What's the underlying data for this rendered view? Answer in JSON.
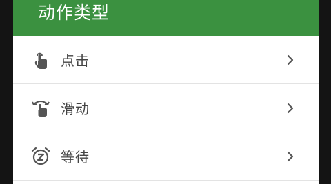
{
  "dialog": {
    "title": "动作类型",
    "accent_color": "#3b9140",
    "items": [
      {
        "label": "点击",
        "icon": "tap-icon"
      },
      {
        "label": "滑动",
        "icon": "swipe-icon"
      },
      {
        "label": "等待",
        "icon": "alarm-clock-icon"
      }
    ]
  }
}
